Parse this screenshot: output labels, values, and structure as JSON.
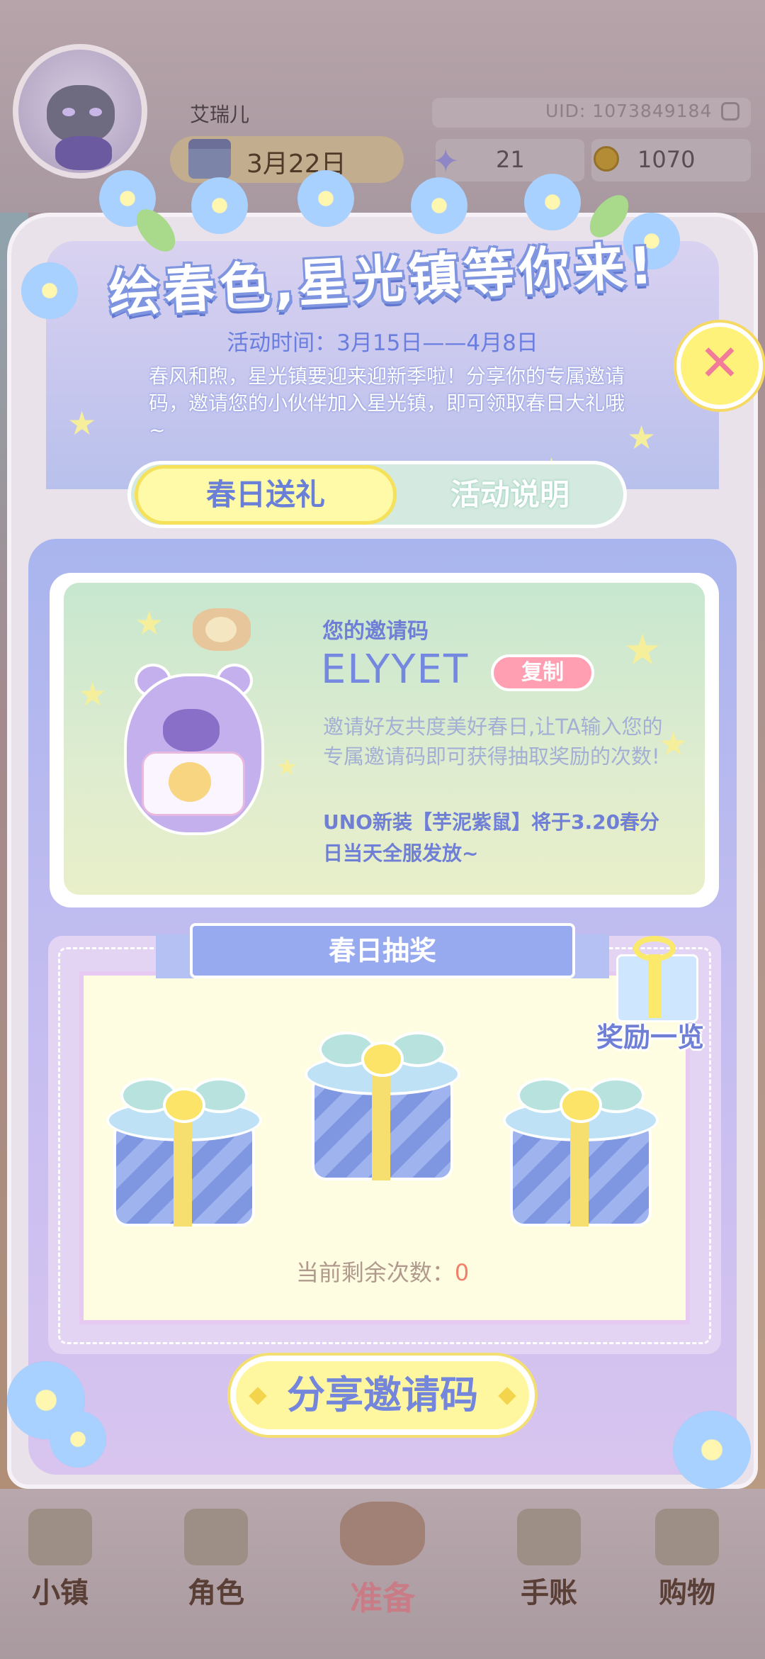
{
  "header": {
    "username": "艾瑞儿",
    "uid": "UID: 1073849184",
    "date": "3月22日",
    "stars": "21",
    "coins": "1070"
  },
  "popup": {
    "title": "绘春色,星光镇等你来!",
    "period": "活动时间：3月15日——4月8日",
    "description": "春风和煦，星光镇要迎来迎新季啦！分享你的专属邀请码，邀请您的小伙伴加入星光镇，即可领取春日大礼哦~",
    "close_symbol": "✕",
    "tabs": [
      {
        "label": "春日送礼",
        "active": true
      },
      {
        "label": "活动说明",
        "active": false
      }
    ],
    "invite": {
      "label": "您的邀请码",
      "code": "ELYYET",
      "copy_label": "复制",
      "description": "邀请好友共度美好春日,让TA输入您的专属邀请码即可获得抽取奖励的次数!",
      "notice": "UNO新装【芋泥紫鼠】将于3.20春分日当天全服发放~"
    },
    "lottery": {
      "title": "春日抽奖",
      "reward_list_label": "奖励一览",
      "remaining_label": "当前剩余次数：",
      "remaining_count": "0"
    },
    "share_button": "分享邀请码"
  },
  "bottom_nav": [
    {
      "label": "小镇",
      "icon": "town-icon"
    },
    {
      "label": "角色",
      "icon": "character-icon"
    },
    {
      "label": "准备",
      "icon": "prepare-icon"
    },
    {
      "label": "手账",
      "icon": "journal-icon"
    },
    {
      "label": "购物",
      "icon": "shop-icon"
    }
  ],
  "colors": {
    "accent_blue": "#7386dc",
    "tab_active": "#fffaa8",
    "copy_pink": "#ff9fb1",
    "remaining_count": "#f0806a"
  }
}
